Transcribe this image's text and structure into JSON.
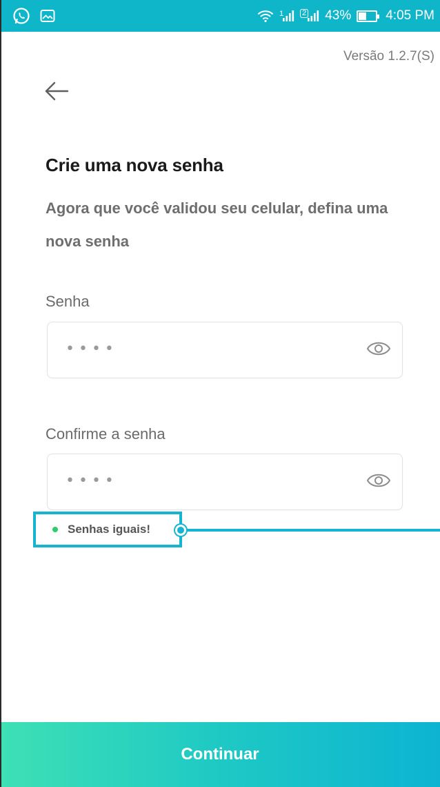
{
  "status_bar": {
    "left_icons": [
      "whatsapp-icon",
      "image-icon"
    ],
    "sim1_label": "1",
    "sim2_label": "2",
    "battery": "43%",
    "time": "4:05 PM"
  },
  "version": "Versão 1.2.7(S)",
  "header": {
    "title": "Crie uma nova senha",
    "subtitle": "Agora que você validou seu celular, defina uma nova senha"
  },
  "password_field": {
    "label": "Senha",
    "value": "••••"
  },
  "confirm_field": {
    "label": "Confirme a senha",
    "value": "••••"
  },
  "match_indicator": {
    "text": "Senhas iguais!"
  },
  "continue_button": {
    "label": "Continuar"
  },
  "colors": {
    "status_bar": "#0fb5c8",
    "accent": "#16b4cf",
    "match_dot": "#2ecc71",
    "button_gradient_start": "#3ee0b4",
    "button_gradient_end": "#0db4d2"
  }
}
